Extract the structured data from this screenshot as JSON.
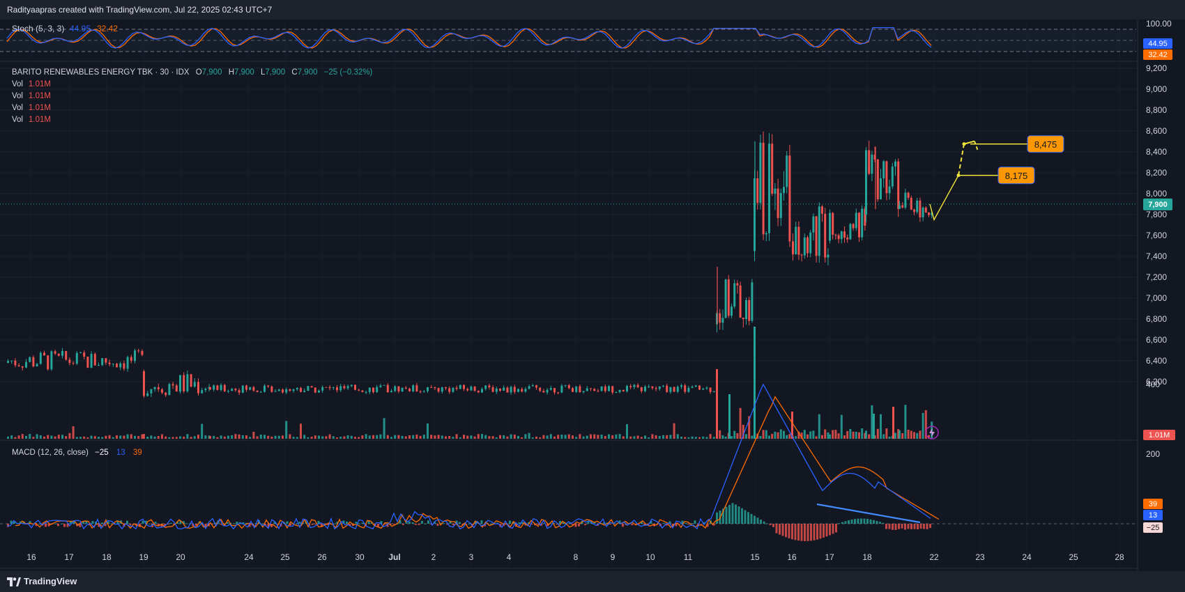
{
  "header": {
    "credit": "Radityaapras created with TradingView.com, Jul 22, 2025 02:43 UTC+7"
  },
  "footer": {
    "brand": "TradingView"
  },
  "colors": {
    "up": "#26a69a",
    "down": "#ef5350",
    "stoch_k": "#2962ff",
    "stoch_d": "#ff6d00",
    "projection": "#f0e33a",
    "badge": "#ff9800"
  },
  "stoch": {
    "title": "Stoch (5, 3, 3)",
    "k_value": "44.95",
    "d_value": "32.42",
    "scale_top": "100.00",
    "k_badge": "44.95",
    "d_badge": "32.42"
  },
  "main": {
    "symbol": "BARITO RENEWABLES ENERGY TBK · 30 · IDX",
    "ohlc": {
      "o_label": "O",
      "o": "7,900",
      "h_label": "H",
      "h": "7,900",
      "l_label": "L",
      "l": "7,900",
      "c_label": "C",
      "c": "7,900",
      "change": "−25 (−0.32%)"
    },
    "vol_rows": [
      {
        "label": "Vol",
        "value": "1.01M"
      },
      {
        "label": "Vol",
        "value": "1.01M"
      },
      {
        "label": "Vol",
        "value": "1.01M"
      },
      {
        "label": "Vol",
        "value": "1.01M"
      }
    ],
    "price_ticks": [
      "9,200",
      "9,000",
      "8,800",
      "8,600",
      "8,400",
      "8,200",
      "8,000",
      "7,800",
      "7,600",
      "7,400",
      "7,200",
      "7,000",
      "6,800",
      "6,600",
      "6,400",
      "6,200"
    ],
    "price_tick_values": [
      9200,
      9000,
      8800,
      8600,
      8400,
      8200,
      8000,
      7800,
      7600,
      7400,
      7200,
      7000,
      6800,
      6600,
      6400,
      6200
    ],
    "last_price_label": "7,900",
    "volume_badge": "1.01M",
    "targets": [
      {
        "label": "8,475",
        "value": 8475
      },
      {
        "label": "8,175",
        "value": 8175
      }
    ]
  },
  "macd": {
    "title": "MACD (12, 26, close)",
    "hist_value": "−25",
    "macd_value": "13",
    "signal_value": "39",
    "ticks": [
      "400",
      "200"
    ],
    "tick_values": [
      400,
      200
    ],
    "badges": {
      "signal": "39",
      "macd": "13",
      "hist": "−25"
    }
  },
  "time_axis": {
    "labels": [
      "16",
      "17",
      "18",
      "19",
      "20",
      "24",
      "25",
      "26",
      "30",
      "Jul",
      "2",
      "3",
      "4",
      "8",
      "9",
      "10",
      "11",
      "15",
      "16",
      "17",
      "18",
      "22",
      "23",
      "24",
      "25",
      "28"
    ],
    "bold_labels": [
      "Jul"
    ]
  },
  "chart_data": {
    "type": "candlestick",
    "symbol": "BARITO RENEWABLES ENERGY TBK",
    "interval": "30",
    "exchange": "IDX",
    "last_close": 7900,
    "price_range": [
      6150,
      9300
    ],
    "price_segments": [
      {
        "period": "Jun 16 – Jun 18",
        "range": [
          6300,
          6500
        ]
      },
      {
        "period": "Jun 19 – Jun 20",
        "range": [
          6050,
          6300
        ]
      },
      {
        "period": "Jun 24 – Jul 11",
        "range": [
          6050,
          6200
        ]
      },
      {
        "period": "Jul 14 gap",
        "range": [
          6750,
          7300
        ]
      },
      {
        "period": "Jul 15 spike",
        "range": [
          7450,
          8500
        ]
      },
      {
        "period": "Jul 16",
        "range": [
          7350,
          7900
        ]
      },
      {
        "period": "Jul 17",
        "range": [
          7550,
          7900
        ]
      },
      {
        "period": "Jul 18",
        "range": [
          7800,
          8450
        ]
      },
      {
        "period": "Jul 21",
        "range": [
          7750,
          8050
        ]
      }
    ],
    "projection_path": [
      7900,
      7750,
      8175,
      8475
    ],
    "target_levels": [
      8175,
      8475
    ],
    "stoch_k_last": 44.95,
    "stoch_d_last": 32.42,
    "macd_hist_last": -25,
    "macd_last": 13,
    "macd_signal_last": 39,
    "macd_peak": 400,
    "volume_last": "1.01M"
  }
}
